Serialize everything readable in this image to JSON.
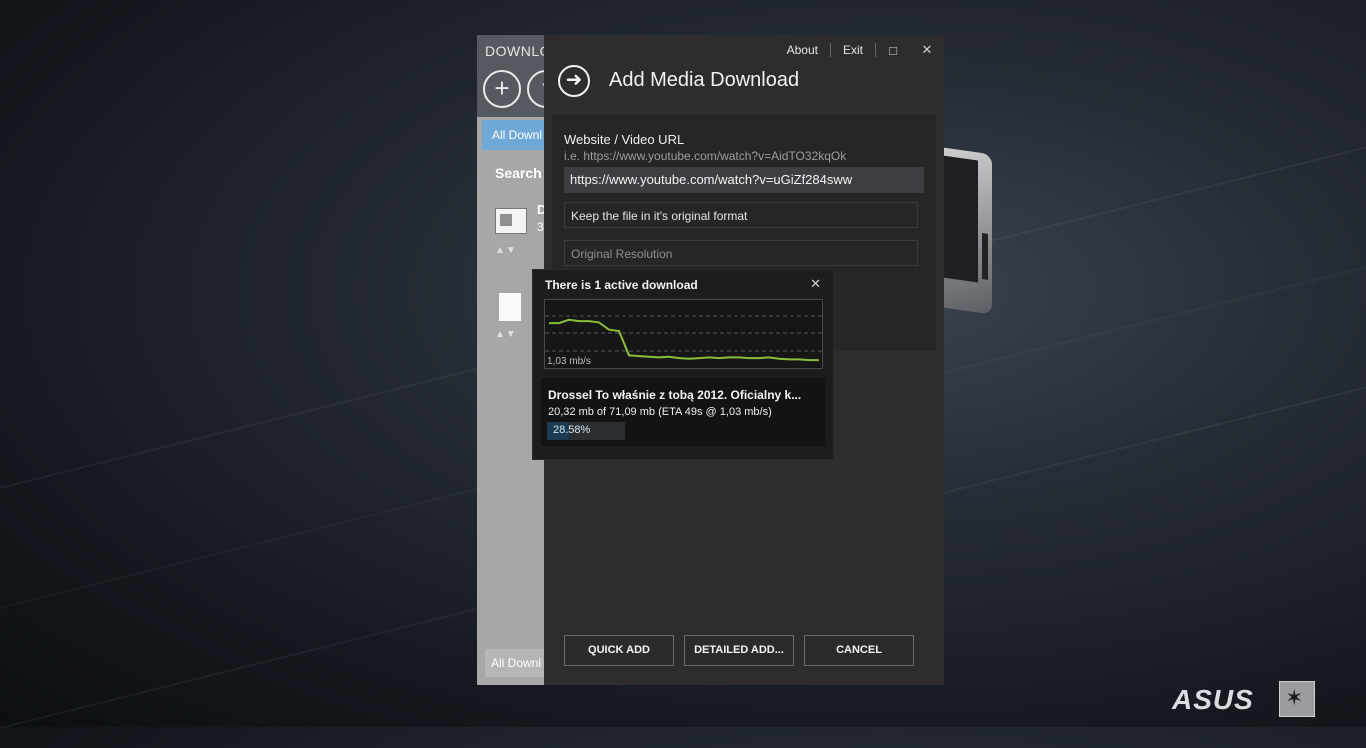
{
  "background_app": {
    "brand": "DOWNLO",
    "tab_all": "All Downl",
    "search_label": "Search I",
    "item1_title": "D",
    "item1_sub": "3",
    "footer_label": "All Downl",
    "yt_icon_text": "Y"
  },
  "dialog": {
    "top_links": [
      "About",
      "Exit"
    ],
    "title": "Add Media Download",
    "url_label": "Website / Video URL",
    "url_hint": "i.e. https://www.youtube.com/watch?v=AidTO32kqOk",
    "url_value": "https://www.youtube.com/watch?v=uGiZf284sww",
    "format_select": "Keep the file in it's original format",
    "resolution_select": "Original Resolution",
    "buttons": {
      "quick_add": "QUICK ADD",
      "detailed_add": "DETAILED ADD...",
      "cancel": "CANCEL"
    }
  },
  "popup": {
    "title": "There is 1 active download",
    "speed_label": "1,03 mb/s",
    "item": {
      "name": "Drossel   To właśnie z tobą 2012. Oficialny k...",
      "size": "20,32 mb of 71,09 mb (ETA 49s @ 1,03 mb/s)",
      "percent_text": "28.58%",
      "progress": 0.2858
    }
  },
  "speed_series": [
    0.35,
    0.35,
    0.3,
    0.32,
    0.32,
    0.34,
    0.45,
    0.47,
    0.84,
    0.85,
    0.86,
    0.87,
    0.86,
    0.88,
    0.89,
    0.88,
    0.87,
    0.88,
    0.87,
    0.87,
    0.88,
    0.88,
    0.87,
    0.89,
    0.9,
    0.9,
    0.91,
    0.91
  ],
  "branding": {
    "logo": "ASUS"
  },
  "colors": {
    "accent_green": "#8bbd3a",
    "tab_blue": "#6fa8d6",
    "progress": "#1b3b52"
  }
}
